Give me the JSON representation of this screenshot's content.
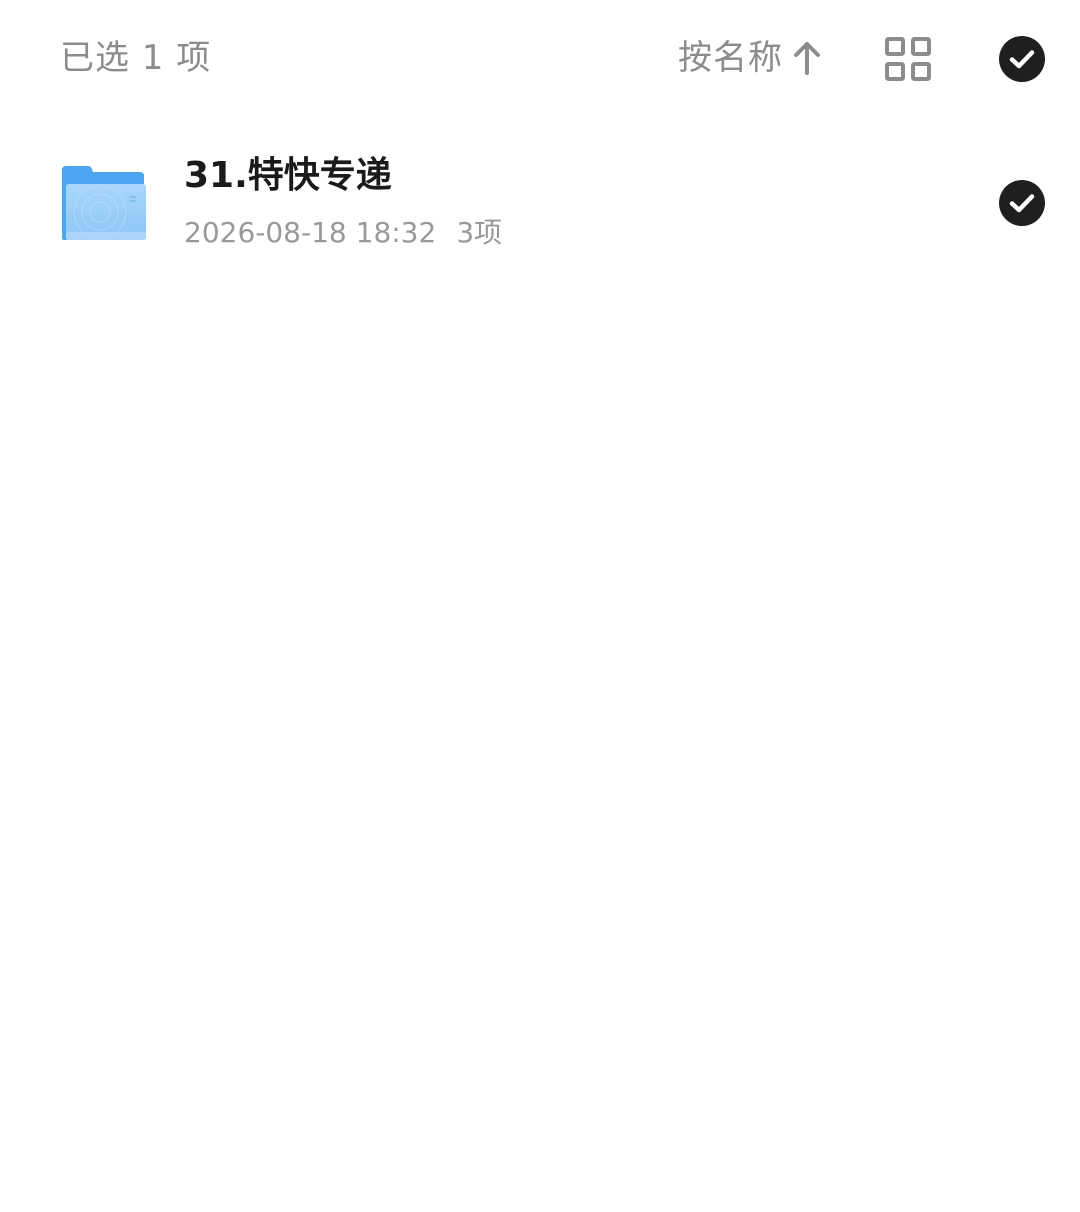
{
  "toolbar": {
    "selection_count": "已选 1 项",
    "sort_label": "按名称",
    "sort_direction_icon": "arrow-up-icon",
    "view_toggle_icon": "grid-view-icon",
    "select_all_icon": "check-circle-icon"
  },
  "files": [
    {
      "name": "31.特快专递",
      "date": "2026-08-18 18:32",
      "count": "3项",
      "type_icon": "folder-icon",
      "selected": true
    }
  ],
  "colors": {
    "text_primary": "#1a1a1a",
    "text_secondary": "#8c8c8c",
    "check_fill": "#1f1f1f",
    "folder_blue": "#4aa6f0",
    "folder_light": "#9fd0f8"
  }
}
